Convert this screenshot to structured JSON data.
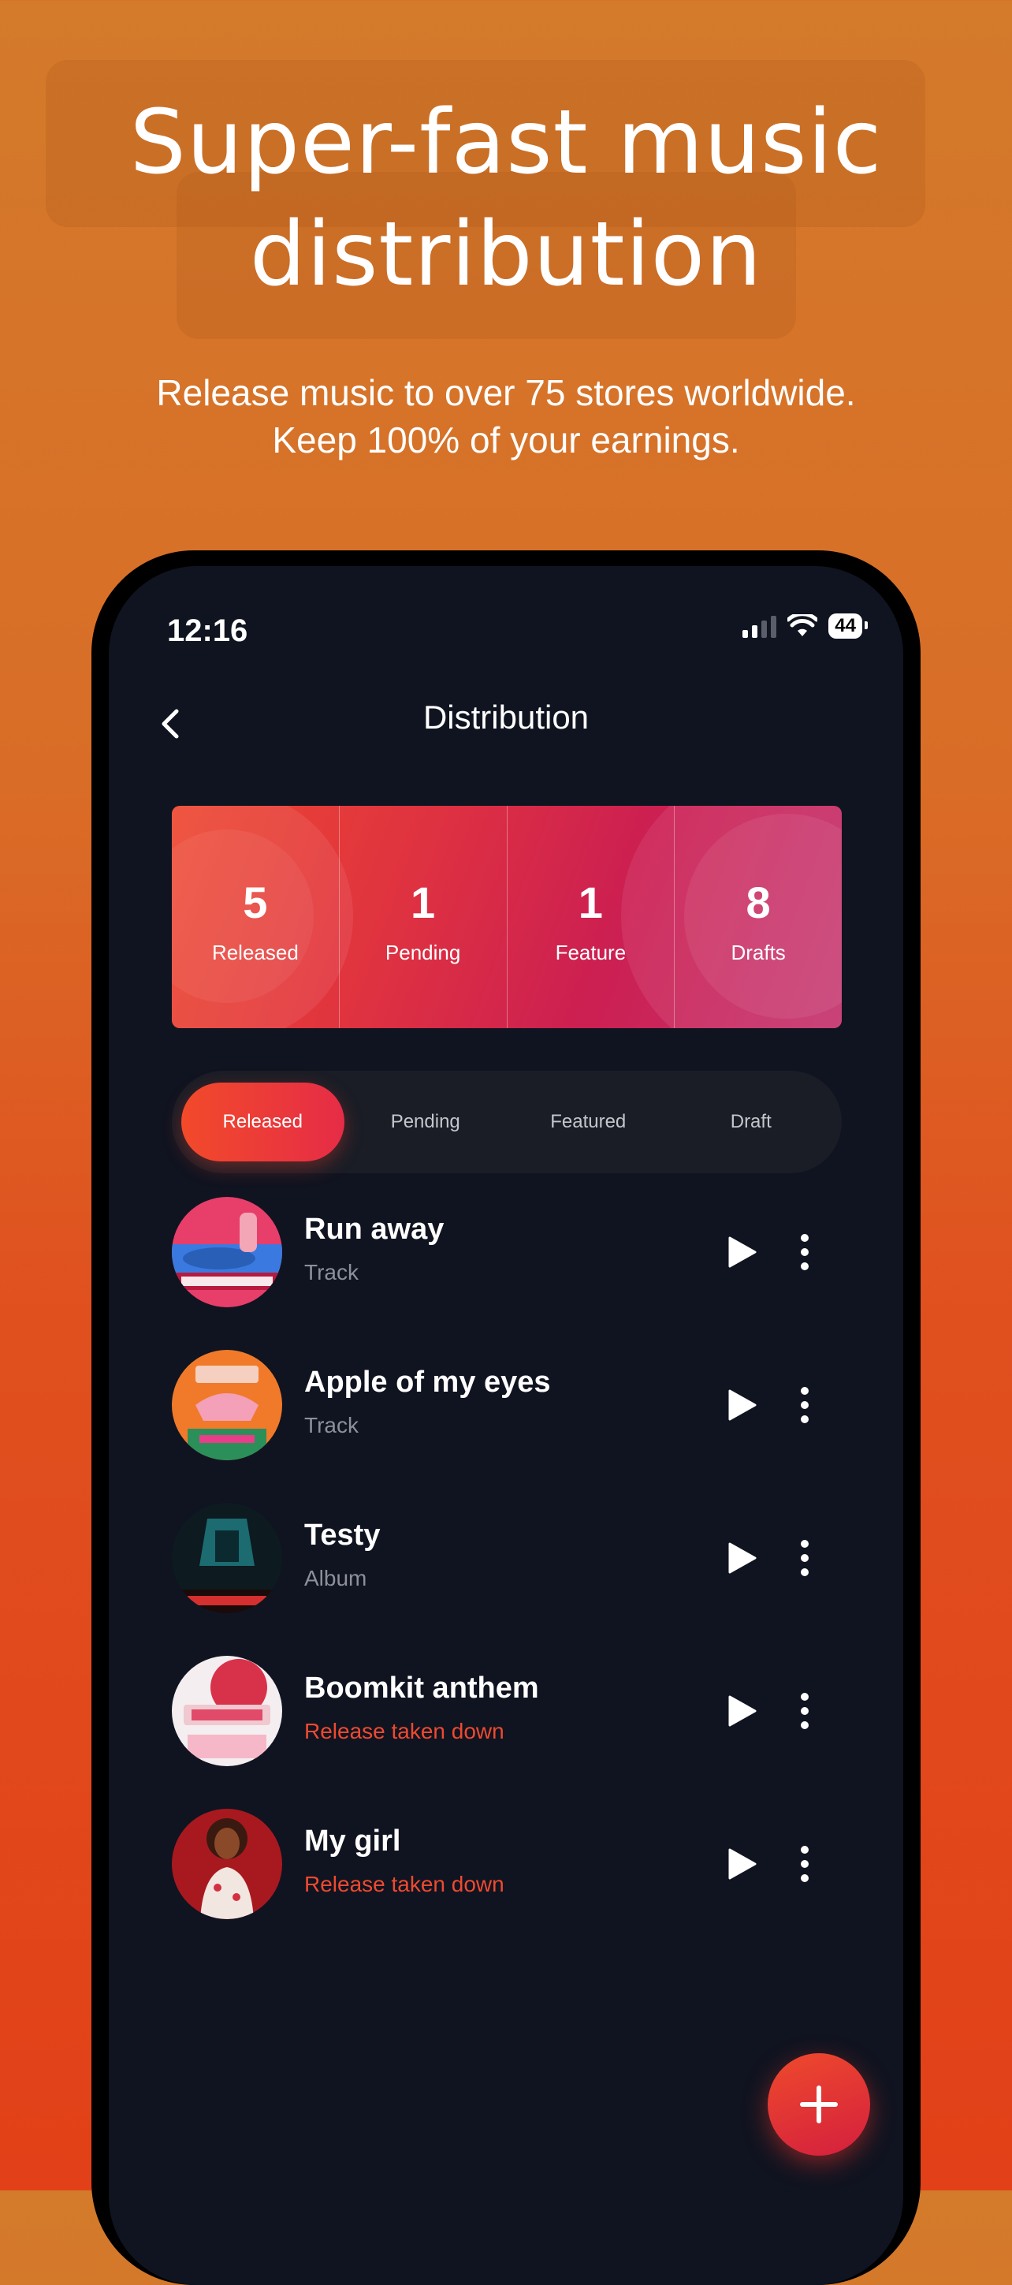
{
  "hero": {
    "title_line1": "Super-fast music",
    "title_line2": "distribution",
    "subtitle_line1": "Release music to over 75 stores worldwide.",
    "subtitle_line2": "Keep 100% of your earnings."
  },
  "status_bar": {
    "time": "12:16",
    "battery": "44"
  },
  "nav": {
    "title": "Distribution",
    "back_icon": "chevron-left-icon"
  },
  "stats": [
    {
      "value": "5",
      "label": "Released"
    },
    {
      "value": "1",
      "label": "Pending"
    },
    {
      "value": "1",
      "label": "Feature"
    },
    {
      "value": "8",
      "label": "Drafts"
    }
  ],
  "tabs": [
    {
      "label": "Released",
      "active": true
    },
    {
      "label": "Pending",
      "active": false
    },
    {
      "label": "Featured",
      "active": false
    },
    {
      "label": "Draft",
      "active": false
    }
  ],
  "releases": [
    {
      "title": "Run away",
      "subtitle": "Track",
      "taken_down": false
    },
    {
      "title": "Apple of my eyes",
      "subtitle": "Track",
      "taken_down": false
    },
    {
      "title": "Testy",
      "subtitle": "Album",
      "taken_down": false
    },
    {
      "title": "Boomkit anthem",
      "subtitle": "Release taken down",
      "taken_down": true
    },
    {
      "title": "My girl",
      "subtitle": "Release taken down",
      "taken_down": true
    }
  ],
  "colors": {
    "accent": "#ee4a30",
    "screen_bg": "#101420",
    "taken_down": "#ee4a30"
  },
  "fab": {
    "icon": "plus-icon"
  }
}
